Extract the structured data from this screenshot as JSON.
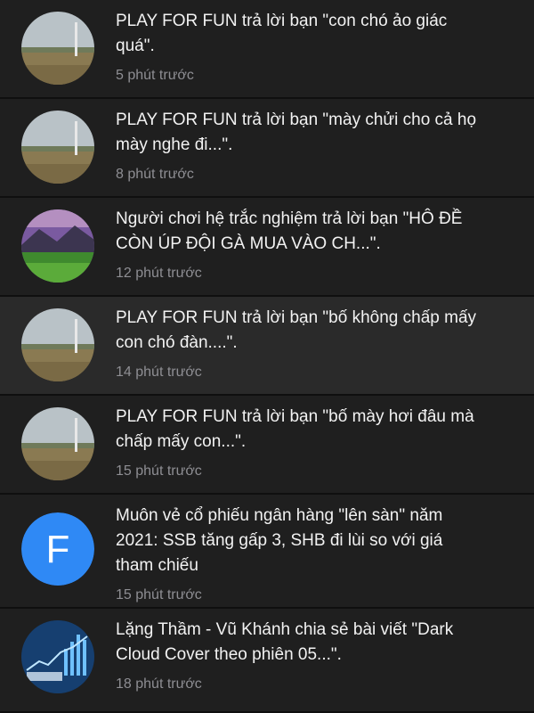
{
  "notifications": [
    {
      "text": "PLAY FOR FUN trả lời bạn \"con chó ảo giác\nquá\".",
      "time": "5 phút trước",
      "avatar": "field-photo-avatar"
    },
    {
      "text": "PLAY FOR FUN trả lời bạn \"mày chửi cho cả họ\nmày nghe đi...\".",
      "time": "8 phút trước",
      "avatar": "field-photo-avatar"
    },
    {
      "text": "Người chơi hệ trắc nghiệm trả lời bạn \"HÔ ĐỀ\nCÒN ÚP ĐỘI GÀ MUA VÀO CH...\".",
      "time": "12 phút trước",
      "avatar": "landscape-photo-avatar"
    },
    {
      "text": "PLAY FOR FUN trả lời bạn \"bố không chấp mấy\ncon chó đàn....\".",
      "time": "14 phút trước",
      "avatar": "field-photo-avatar"
    },
    {
      "text": "PLAY FOR FUN trả lời bạn \"bố mày hơi đâu mà\nchấp mấy con...\".",
      "time": "15 phút trước",
      "avatar": "field-photo-avatar"
    },
    {
      "text": "Muôn vẻ cổ phiếu ngân hàng \"lên sàn\" năm\n2021: SSB tăng gấp 3, SHB đi lùi so với giá\ntham chiếu",
      "time": "15 phút trước",
      "avatar": "letter-avatar",
      "avatar_letter": "F",
      "avatar_color": "#2f89f5"
    },
    {
      "text": "Lặng Thầm - Vũ Khánh chia sẻ bài viết \"Dark\nCloud Cover theo phiên 05...\".",
      "time": "18 phút trước",
      "avatar": "chart-photo-avatar"
    }
  ]
}
